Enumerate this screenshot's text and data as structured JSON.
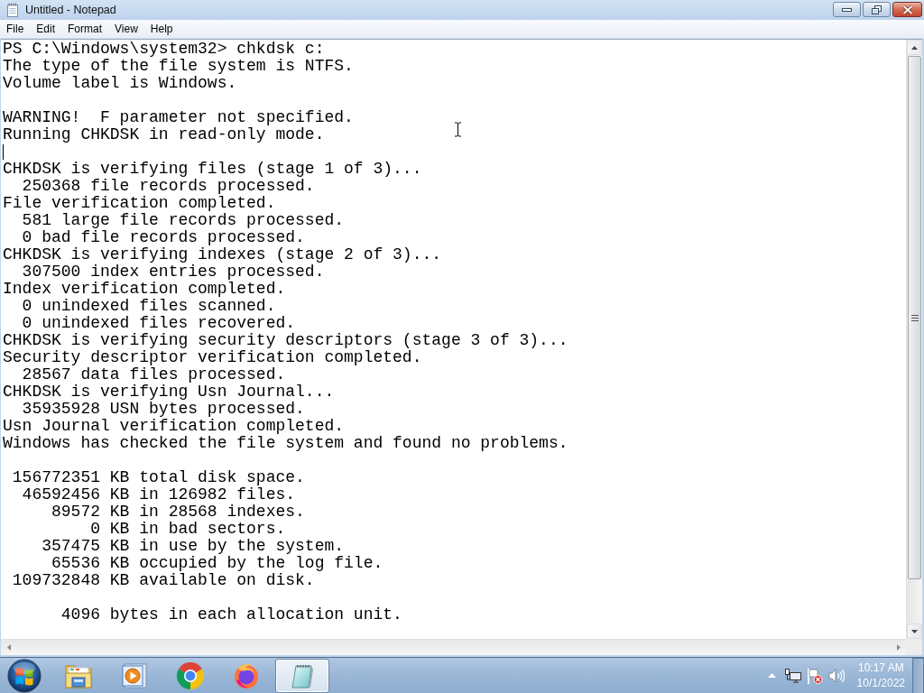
{
  "window": {
    "title": "Untitled - Notepad"
  },
  "menu": [
    "File",
    "Edit",
    "Format",
    "View",
    "Help"
  ],
  "document": {
    "blocks": [
      {
        "caret_before": false,
        "lines": [
          "PS C:\\Windows\\system32> chkdsk c:",
          "The type of the file system is NTFS.",
          "Volume label is Windows."
        ]
      },
      {
        "caret_before": false,
        "lines": [
          "WARNING!  F parameter not specified.",
          "Running CHKDSK in read-only mode."
        ]
      },
      {
        "caret_before": true,
        "lines": [
          "CHKDSK is verifying files (stage 1 of 3)...",
          "  250368 file records processed.",
          "File verification completed.",
          "  581 large file records processed.",
          "  0 bad file records processed.",
          "CHKDSK is verifying indexes (stage 2 of 3)...",
          "  307500 index entries processed.",
          "Index verification completed.",
          "  0 unindexed files scanned.",
          "  0 unindexed files recovered.",
          "CHKDSK is verifying security descriptors (stage 3 of 3)...",
          "Security descriptor verification completed.",
          "  28567 data files processed.",
          "CHKDSK is verifying Usn Journal...",
          "  35935928 USN bytes processed.",
          "Usn Journal verification completed.",
          "Windows has checked the file system and found no problems."
        ]
      },
      {
        "caret_before": false,
        "lines": [
          " 156772351 KB total disk space.",
          "  46592456 KB in 126982 files.",
          "     89572 KB in 28568 indexes.",
          "         0 KB in bad sectors.",
          "    357475 KB in use by the system.",
          "     65536 KB occupied by the log file.",
          " 109732848 KB available on disk."
        ]
      },
      {
        "caret_before": false,
        "lines": [
          "      4096 bytes in each allocation unit."
        ]
      }
    ]
  },
  "taskbar": {
    "apps": [
      {
        "kind": "explorer",
        "selected": false
      },
      {
        "kind": "media",
        "selected": false
      },
      {
        "kind": "chrome",
        "selected": false
      },
      {
        "kind": "firefox",
        "selected": false
      },
      {
        "kind": "notepad",
        "selected": true
      }
    ],
    "clock": {
      "time": "10:17 AM",
      "date": "10/1/2022"
    }
  }
}
